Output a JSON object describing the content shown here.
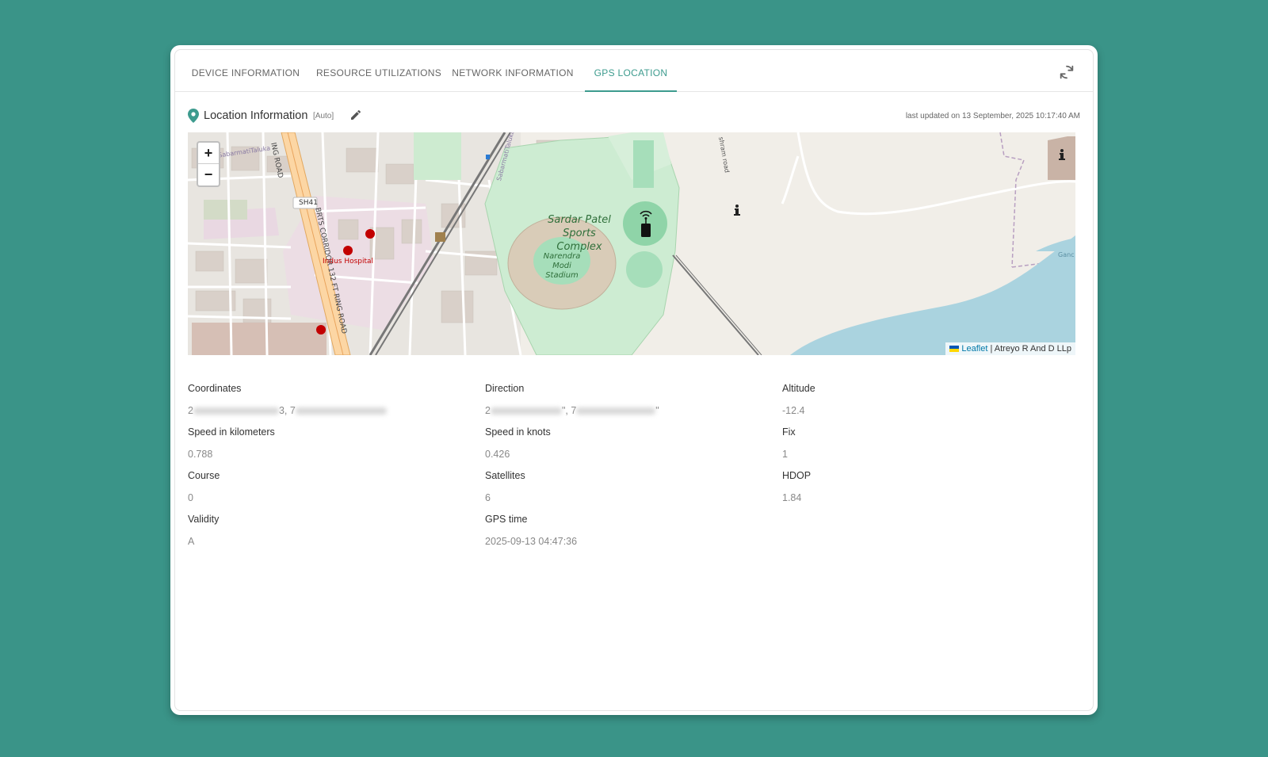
{
  "tabs": [
    {
      "label": "DEVICE INFORMATION",
      "active": false
    },
    {
      "label": "RESOURCE UTILIZATIONS",
      "active": false
    },
    {
      "label": "NETWORK INFORMATION",
      "active": false
    },
    {
      "label": "GPS LOCATION",
      "active": true
    }
  ],
  "location": {
    "title": "Location Information",
    "mode": "[Auto]",
    "last_updated": "last updated on 13 September, 2025 10:17:40 AM"
  },
  "map": {
    "zoom_in": "+",
    "zoom_out": "−",
    "attribution_link": "Leaflet",
    "attribution_text": " | Atreyo R And D LLp",
    "labels": {
      "complex": "Sardar Patel Sports Complex",
      "stadium": "Narendra Modi Stadium",
      "hospital": "Indus Hospital",
      "road": "BRTS CORRIDOR 132 FT RING ROAD",
      "road_top": "ING ROAD",
      "highway": "SH41",
      "taluka_1": "SabarmatiTaluka",
      "taluka_2": "SabarmatiTaluka",
      "ashram_road": "shram road",
      "water": "Ganc"
    }
  },
  "details": {
    "coordinates": {
      "label": "Coordinates",
      "value_prefix": "2",
      "value_mid": "3, 7"
    },
    "direction": {
      "label": "Direction",
      "value_prefix": "2",
      "value_mid": "\", 7",
      "value_suffix": "\""
    },
    "altitude": {
      "label": "Altitude",
      "value": "-12.4"
    },
    "speed_km": {
      "label": "Speed in kilometers",
      "value": "0.788"
    },
    "speed_knots": {
      "label": "Speed in knots",
      "value": "0.426"
    },
    "fix": {
      "label": "Fix",
      "value": "1"
    },
    "course": {
      "label": "Course",
      "value": "0"
    },
    "satellites": {
      "label": "Satellites",
      "value": "6"
    },
    "hdop": {
      "label": "HDOP",
      "value": "1.84"
    },
    "validity": {
      "label": "Validity",
      "value": "A"
    },
    "gps_time": {
      "label": "GPS time",
      "value": "2025-09-13 04:47:36"
    }
  },
  "colors": {
    "accent": "#3d9b8e",
    "background": "#3a9488",
    "map_park": "#c8eccf",
    "map_water": "#aad3df"
  }
}
